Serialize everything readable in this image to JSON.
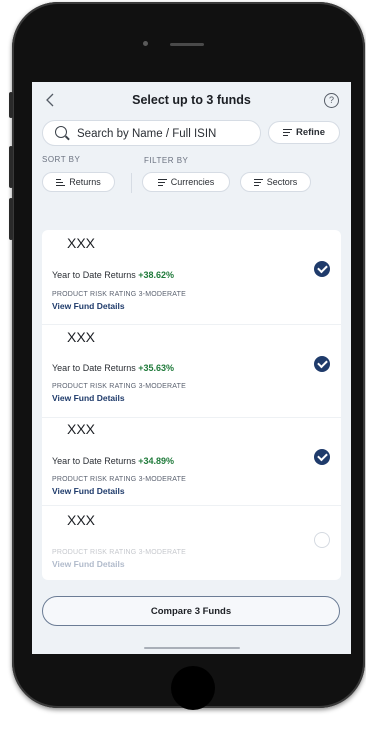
{
  "header": {
    "back_icon": "chevron-left-icon",
    "title": "Select up to 3 funds",
    "help_icon": "question-mark-icon",
    "help_glyph": "?"
  },
  "search": {
    "placeholder": "Search by Name / Full ISIN",
    "refine_label": "Refine"
  },
  "sort": {
    "label": "SORT BY",
    "selected": "Returns"
  },
  "filter": {
    "label": "FILTER BY",
    "options": [
      "Currencies",
      "Sectors"
    ]
  },
  "funds": [
    {
      "name": "XXX",
      "ytd_label": "Year to Date Returns",
      "ytd_value": "+38.62%",
      "risk": "PRODUCT RISK RATING 3-MODERATE",
      "details_link": "View Fund Details",
      "selected": true
    },
    {
      "name": "XXX",
      "ytd_label": "Year to Date Returns",
      "ytd_value": "+35.63%",
      "risk": "PRODUCT RISK RATING 3-MODERATE",
      "details_link": "View Fund Details",
      "selected": true
    },
    {
      "name": "XXX",
      "ytd_label": "Year to Date Returns",
      "ytd_value": "+34.89%",
      "risk": "PRODUCT RISK RATING 3-MODERATE",
      "details_link": "View Fund Details",
      "selected": true
    },
    {
      "name": "XXX",
      "risk": "PRODUCT RISK RATING 3-MODERATE",
      "details_link": "View Fund Details",
      "selected": false
    }
  ],
  "compare_button": "Compare 3 Funds",
  "colors": {
    "accent": "#1f3b6b",
    "positive": "#1f7a3a",
    "screen_bg": "#eef2f6"
  }
}
